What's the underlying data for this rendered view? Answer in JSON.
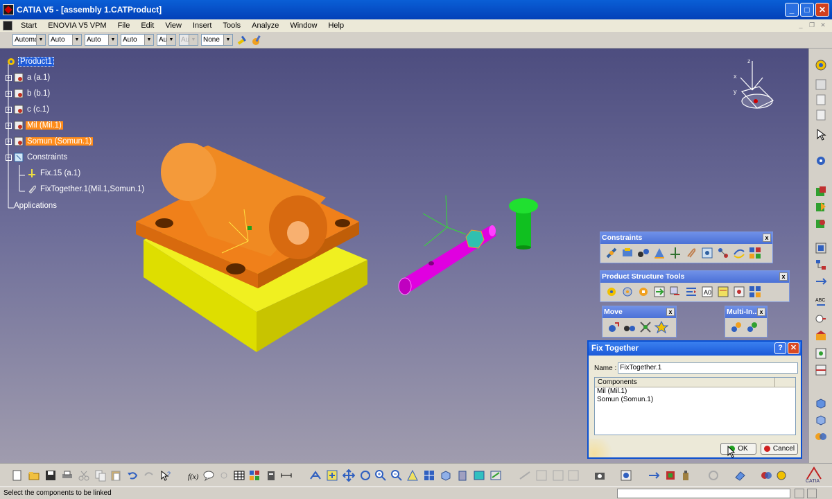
{
  "window": {
    "title": "CATIA V5 - [assembly 1.CATProduct]",
    "min": "_",
    "max": "□",
    "close": "✕"
  },
  "menu": [
    "Start",
    "ENOVIA V5 VPM",
    "File",
    "Edit",
    "View",
    "Insert",
    "Tools",
    "Analyze",
    "Window",
    "Help"
  ],
  "property_toolbar": {
    "combos": [
      "Automa",
      "Auto",
      "Auto",
      "Auto",
      "Aut",
      "Aut",
      "None"
    ]
  },
  "tree": {
    "root": "Product1",
    "items": [
      "a (a.1)",
      "b (b.1)",
      "c (c.1)",
      "Mil (Mil.1)",
      "Somun (Somun.1)",
      "Constraints",
      "Fix.15 (a.1)",
      "FixTogether.1(Mil.1,Somun.1)",
      "Applications"
    ]
  },
  "compass": {
    "x": "x",
    "y": "y",
    "z": "z"
  },
  "panels": {
    "constraints": "Constraints",
    "product_structure": "Product Structure Tools",
    "move": "Move",
    "multi": "Multi-In...",
    "close": "x"
  },
  "dialog": {
    "title": "Fix Together",
    "help": "?",
    "close": "✕",
    "name_label": "Name :",
    "name_value": "FixTogether.1",
    "components_header": "Components",
    "components": [
      "Mil (Mil.1)",
      "Somun (Somun.1)"
    ],
    "ok": "OK",
    "cancel": "Cancel"
  },
  "status": {
    "message": "Select the components to be linked"
  },
  "colors": {
    "title_blue": "#0a5fd6",
    "part_orange": "#f07a10",
    "part_yellow": "#e8e000",
    "part_magenta": "#e000e0",
    "part_green": "#10d020",
    "highlight_orange": "#ff8c1a"
  }
}
